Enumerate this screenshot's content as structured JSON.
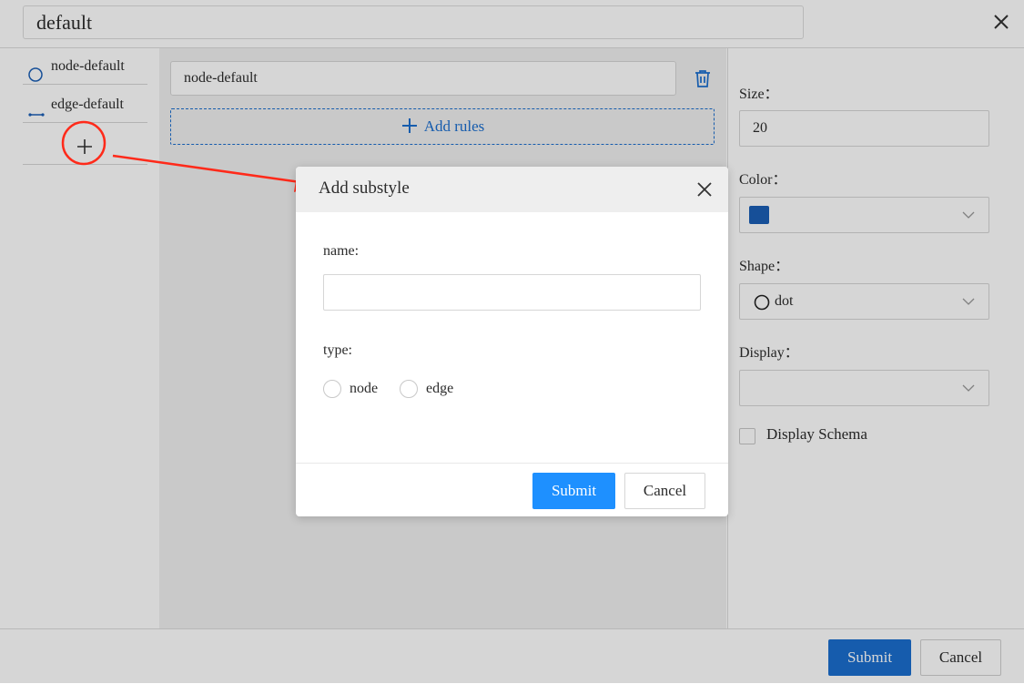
{
  "header": {
    "style_name": "default",
    "close_icon": "close-icon"
  },
  "styles_list": {
    "items": [
      {
        "label": "node-default",
        "icon": "circle-icon"
      },
      {
        "label": "edge-default",
        "icon": "line-icon"
      }
    ],
    "add_icon": "plus-icon"
  },
  "rules": {
    "current": "node-default",
    "delete_icon": "trash-icon",
    "add_label": "Add rules"
  },
  "properties": {
    "size_label": "Size：",
    "size_value": "20",
    "color_label": "Color：",
    "color_value": "#1b5fb5",
    "shape_label": "Shape：",
    "shape_value": "dot",
    "display_label": "Display：",
    "display_value": "",
    "schema_label": "Display Schema",
    "schema_checked": false
  },
  "footer": {
    "submit": "Submit",
    "cancel": "Cancel"
  },
  "dialog": {
    "title": "Add substyle",
    "name_label": "name:",
    "name_value": "",
    "type_label": "type:",
    "type_options": [
      "node",
      "edge"
    ],
    "submit": "Submit",
    "cancel": "Cancel"
  },
  "colors": {
    "primary": "#1b6ecf",
    "dialog_primary": "#1e90ff",
    "annotation": "#ff2a1a"
  }
}
